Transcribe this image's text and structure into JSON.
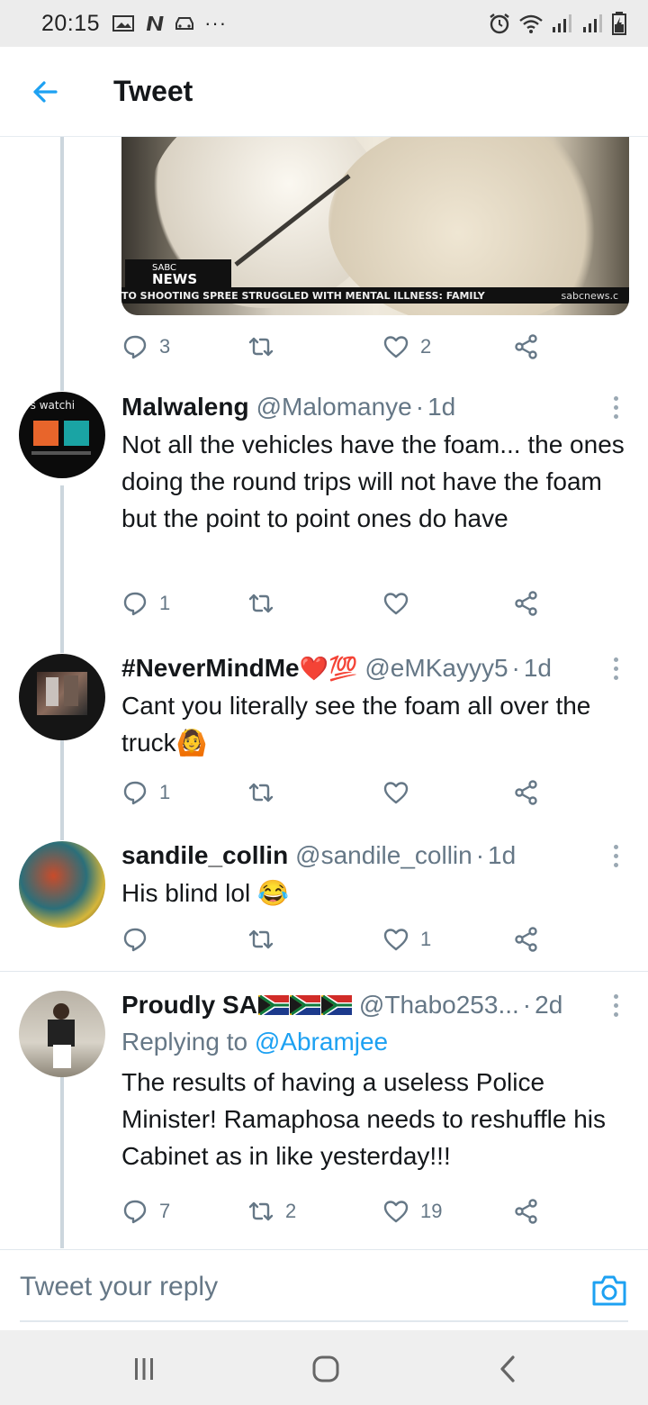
{
  "status_bar": {
    "time": "20:15",
    "more": "···"
  },
  "header": {
    "title": "Tweet"
  },
  "media": {
    "logo_top": "SABC",
    "logo_bottom": "NEWS",
    "ticker": "TO SHOOTING SPREE STRUGGLED WITH MENTAL ILLNESS: FAMILY",
    "ticker_site": "sabcnews.c"
  },
  "parent_actions": {
    "replies": "3",
    "retweets": "",
    "likes": "2"
  },
  "tweets": [
    {
      "name": "Malwaleng",
      "handle": "@Malomanye",
      "age": "1d",
      "text": "Not all the vehicles have the foam... the ones doing the round trips will not have the foam but the point to point ones do have",
      "replies": "1",
      "retweets": "",
      "likes": "",
      "avatar_text": "o's watchi"
    },
    {
      "name": "#NeverMindMe",
      "name_emoji": "❤️💯",
      "handle": "@eMKayyy5",
      "age": "1d",
      "text": "Cant you literally see the foam all over the truck",
      "text_emoji": "🙆",
      "replies": "1",
      "retweets": "",
      "likes": ""
    },
    {
      "name": "sandile_collin",
      "handle": "@sandile_collin",
      "age": "1d",
      "text": "His blind lol",
      "text_emoji": "😂",
      "replies": "",
      "retweets": "",
      "likes": "1"
    },
    {
      "name": "Proudly SA",
      "handle": "@Thabo253...",
      "age": "2d",
      "replying_prefix": "Replying to",
      "replying_to": "@Abramjee",
      "text": "The results of having a useless Police Minister! Ramaphosa needs to reshuffle his Cabinet as in like yesterday!!!",
      "replies": "7",
      "retweets": "2",
      "likes": "19"
    }
  ],
  "reply_bar": {
    "placeholder": "Tweet your reply"
  },
  "colors": {
    "accent": "#1da1f2",
    "muted": "#657786",
    "text": "#14171a",
    "thread": "#ccd6dd"
  },
  "icons": [
    "back-arrow-icon",
    "reply-icon",
    "retweet-icon",
    "heart-icon",
    "share-icon",
    "more-icon",
    "camera-icon",
    "recent-apps-icon",
    "home-icon",
    "back-icon"
  ]
}
